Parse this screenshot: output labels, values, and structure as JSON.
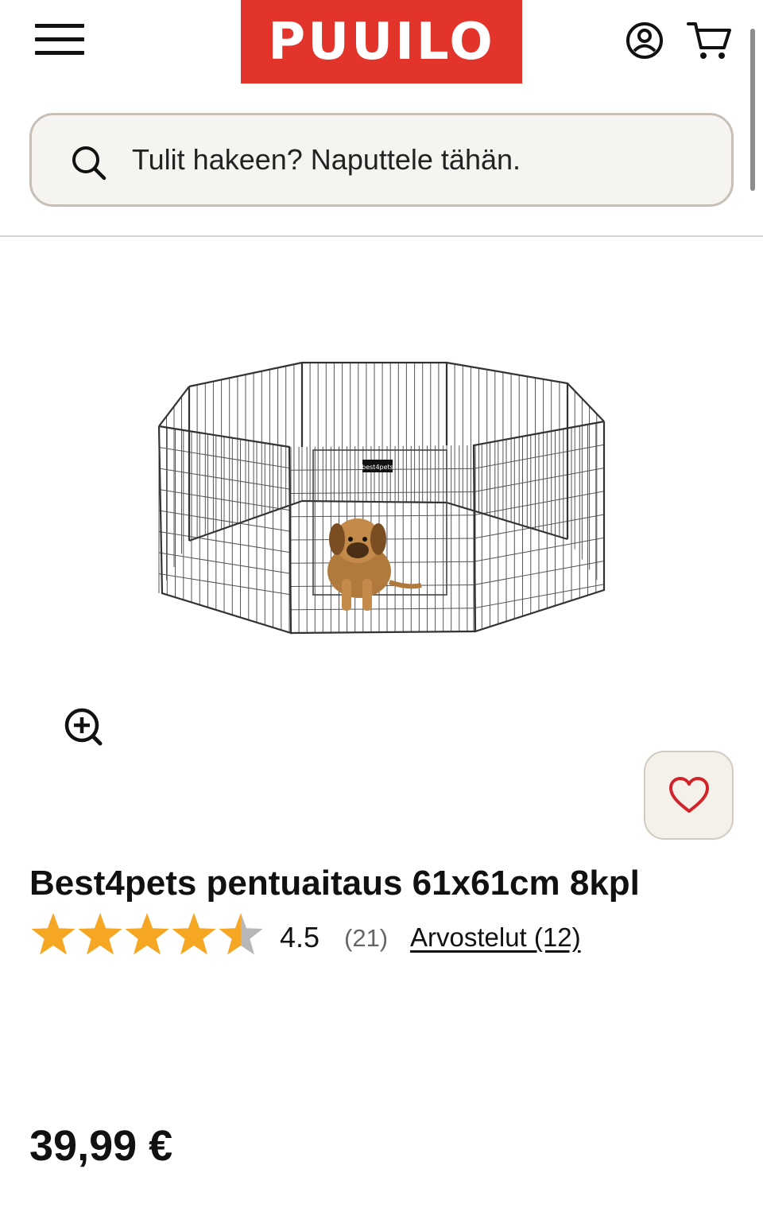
{
  "header": {
    "menu_icon": "hamburger-menu-icon",
    "logo_text": "PUUILO",
    "logo_color": "#e2342b",
    "account_icon": "user-account-icon",
    "cart_icon": "shopping-cart-icon"
  },
  "search": {
    "icon": "search-icon",
    "placeholder": "Tulit hakeen? Naputtele tähän.",
    "value": ""
  },
  "gallery": {
    "image_alt": "dog playpen with puppy",
    "zoom_icon": "zoom-in-icon",
    "favorite_icon": "heart-icon",
    "brand_tag": "best4pets"
  },
  "product": {
    "title": "Best4pets pentuaitaus 61x61cm 8kpl",
    "rating": {
      "value": "4.5",
      "stars_filled": 4.5,
      "stars_max": 5,
      "count": "(21)",
      "reviews_link": "Arvostelut (12)",
      "star_color": "#f5a623",
      "star_empty_color": "#b7b7b7"
    },
    "price": "39,99 €"
  }
}
